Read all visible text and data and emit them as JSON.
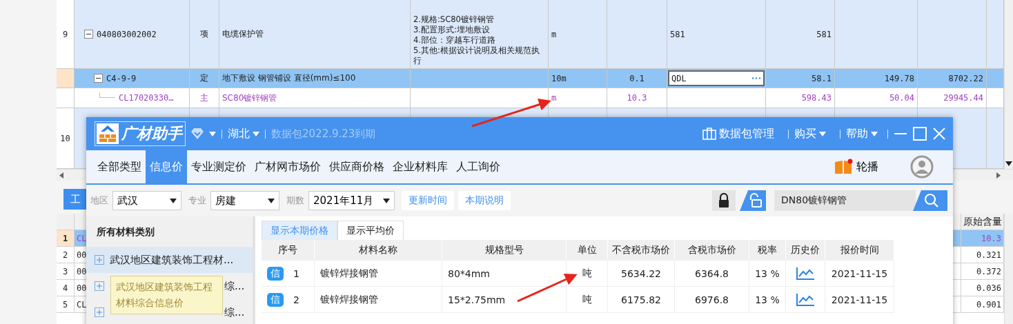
{
  "sheet": {
    "rows": [
      {
        "kind": "item",
        "selected": false,
        "expanded": true,
        "number": "9",
        "code": "040803002002",
        "type": "项",
        "name": "电缆保护管",
        "description": "2.规格:SC80镀锌钢管\n3.配置形式:埋地敷设\n4.部位：穿越车行道路\n5.其他:根据设计说明及相关规范执行",
        "unit": "m",
        "quantity": "",
        "formula": "581",
        "amount": "581",
        "price": "",
        "total": ""
      },
      {
        "kind": "quota",
        "selected": true,
        "expanded": true,
        "number": "",
        "code": "C4-9-9",
        "type": "定",
        "name": "地下敷设 钢管铺设 直径(mm)≤100",
        "description": "",
        "unit": "10m",
        "quantity": "0.1",
        "formula": "QDL",
        "amount": "58.1",
        "price": "149.78",
        "total": "8702.22"
      },
      {
        "kind": "material",
        "selected": false,
        "number": "",
        "code": "CL17020330…",
        "type": "主",
        "name": "SC80镀锌钢管",
        "description": "",
        "unit": "m",
        "quantity": "10.3",
        "formula": "",
        "amount": "598.43",
        "price": "50.04",
        "total": "29945.44"
      },
      {
        "kind": "item",
        "selected": false,
        "number": "10",
        "code": "",
        "type": "",
        "name": "",
        "description": "",
        "unit": "",
        "quantity": "",
        "formula": "",
        "amount": "",
        "price": "",
        "total": ""
      }
    ]
  },
  "lower": {
    "tabs": [
      {
        "label": "工",
        "selected": true
      }
    ],
    "column_header": "原始含量",
    "rows": [
      {
        "number": "1",
        "column_2": "CL",
        "original_amount": "10.3",
        "selected": true
      },
      {
        "number": "2",
        "column_2": "00",
        "original_amount": "0.321",
        "selected": false
      },
      {
        "number": "3",
        "column_2": "00",
        "original_amount": "0.372",
        "selected": false
      },
      {
        "number": "4",
        "column_2": "00",
        "original_amount": "0.036",
        "selected": false
      },
      {
        "number": "5",
        "column_2": "CL",
        "original_amount": "0.901",
        "selected": false
      }
    ]
  },
  "popup": {
    "brand": "广材助手",
    "region": "湖北",
    "package_note": "数据包2022.9.23到期",
    "package_manage": "数据包管理",
    "menus": [
      "购买",
      "帮助"
    ],
    "tabs": [
      {
        "label": "全部类型",
        "selected": false
      },
      {
        "label": "信息价",
        "selected": true
      },
      {
        "label": "专业测定价",
        "selected": false
      },
      {
        "label": "广材网市场价",
        "selected": false
      },
      {
        "label": "供应商价格",
        "selected": false
      },
      {
        "label": "企业材料库",
        "selected": false
      },
      {
        "label": "人工询价",
        "selected": false
      }
    ],
    "carousel": "轮播",
    "filters": [
      {
        "label": "地区",
        "value": "武汉"
      },
      {
        "label": "专业",
        "value": "房建"
      },
      {
        "label": "期数",
        "value": "2021年11月"
      }
    ],
    "links": [
      "更新时间",
      "本期说明"
    ],
    "search": {
      "value": "DN80镀锌钢管"
    },
    "category_header": "所有材料类别",
    "categories": [
      {
        "label": "武汉地区建筑装饰工程材...",
        "selected": true
      },
      {
        "label": "综...",
        "selected": false
      },
      {
        "label": "综...",
        "selected": false
      }
    ],
    "tooltip": "武汉地区建筑装饰工程材料综合信息价",
    "price_tabs": [
      {
        "label": "显示本期价格",
        "selected": true
      },
      {
        "label": "显示平均价",
        "selected": false
      }
    ],
    "columns": [
      "序号",
      "材料名称",
      "规格型号",
      "单位",
      "不含税市场价",
      "含税市场价",
      "税率",
      "历史价",
      "报价时间"
    ],
    "rows": [
      {
        "badge": "信",
        "index": "1",
        "name": "镀锌焊接钢管",
        "spec": "80*4mm",
        "unit": "吨",
        "price_ex_tax": "5634.22",
        "price_inc_tax": "6364.8",
        "tax_rate": "13 %",
        "date": "2021-11-15"
      },
      {
        "badge": "信",
        "index": "2",
        "name": "镀锌焊接钢管",
        "spec": "15*2.75mm",
        "unit": "吨",
        "price_ex_tax": "6175.82",
        "price_inc_tax": "6976.8",
        "tax_rate": "13 %",
        "date": "2021-11-15"
      }
    ]
  }
}
